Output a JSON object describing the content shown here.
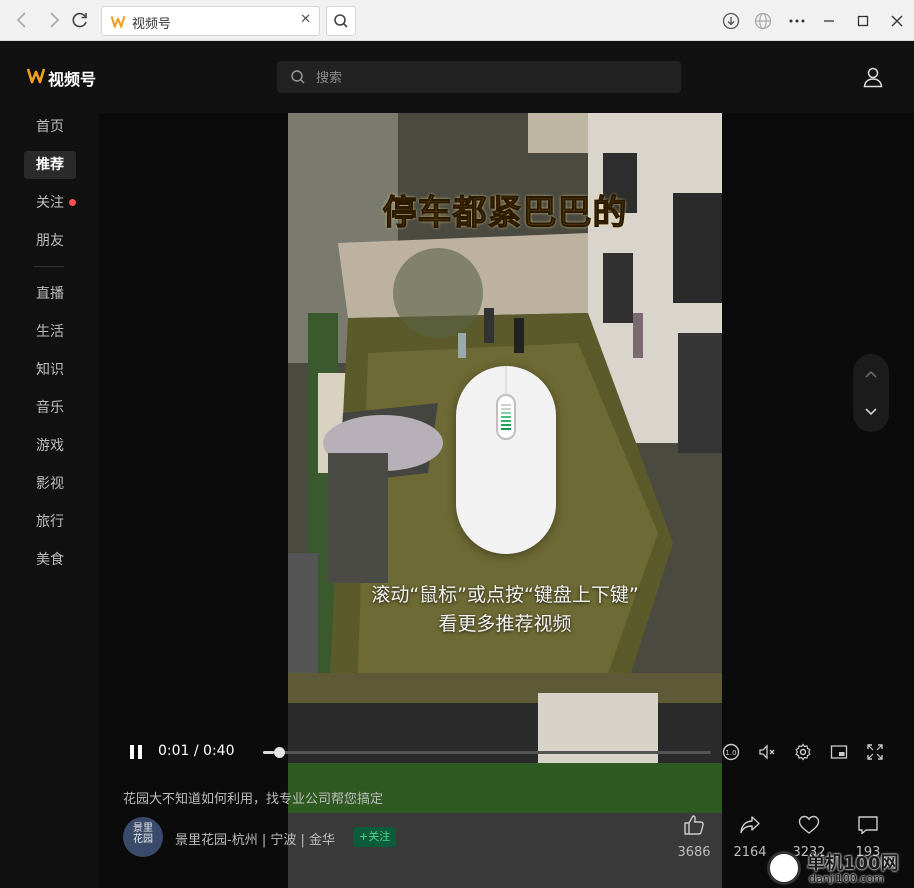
{
  "browser": {
    "tab_title": "视频号",
    "back_icon": "arrow-left",
    "forward_icon": "arrow-right",
    "refresh_icon": "refresh",
    "close_tab_glyph": "✕"
  },
  "app": {
    "title": "视频号",
    "search": {
      "placeholder": "搜索",
      "value": ""
    },
    "sidebar": {
      "items": [
        {
          "label": "首页"
        },
        {
          "label": "推荐",
          "active": true
        },
        {
          "label": "关注",
          "has_dot": true
        },
        {
          "label": "朋友"
        },
        {
          "label": "直播"
        },
        {
          "label": "生活"
        },
        {
          "label": "知识"
        },
        {
          "label": "音乐"
        },
        {
          "label": "游戏"
        },
        {
          "label": "影视"
        },
        {
          "label": "旅行"
        },
        {
          "label": "美食"
        }
      ]
    },
    "video": {
      "caption": "停车都紧巴巴的",
      "overlay_tip_line1": "滚动“鼠标”或点按“键盘上下键”",
      "overlay_tip_line2": "看更多推荐视频",
      "time": "0:01 / 0:40",
      "progress": 0.025,
      "description": "花园大不知道如何利用，找专业公司帮您搞定",
      "author_name": "景里花园-杭州 | 宁波 | 金华",
      "author_avatar_text": "景里\n花园",
      "follow_label": "+关注",
      "stats": {
        "likes": "3686",
        "shares": "2164",
        "favorites": "3232",
        "comments": "193"
      }
    },
    "watermark": {
      "line1": "单机100网",
      "line2": "danji100.com"
    }
  },
  "colors": {
    "accent_red": "#fa5151",
    "follow_green": "#4fd18b",
    "logo_orange": "#f0a020"
  }
}
